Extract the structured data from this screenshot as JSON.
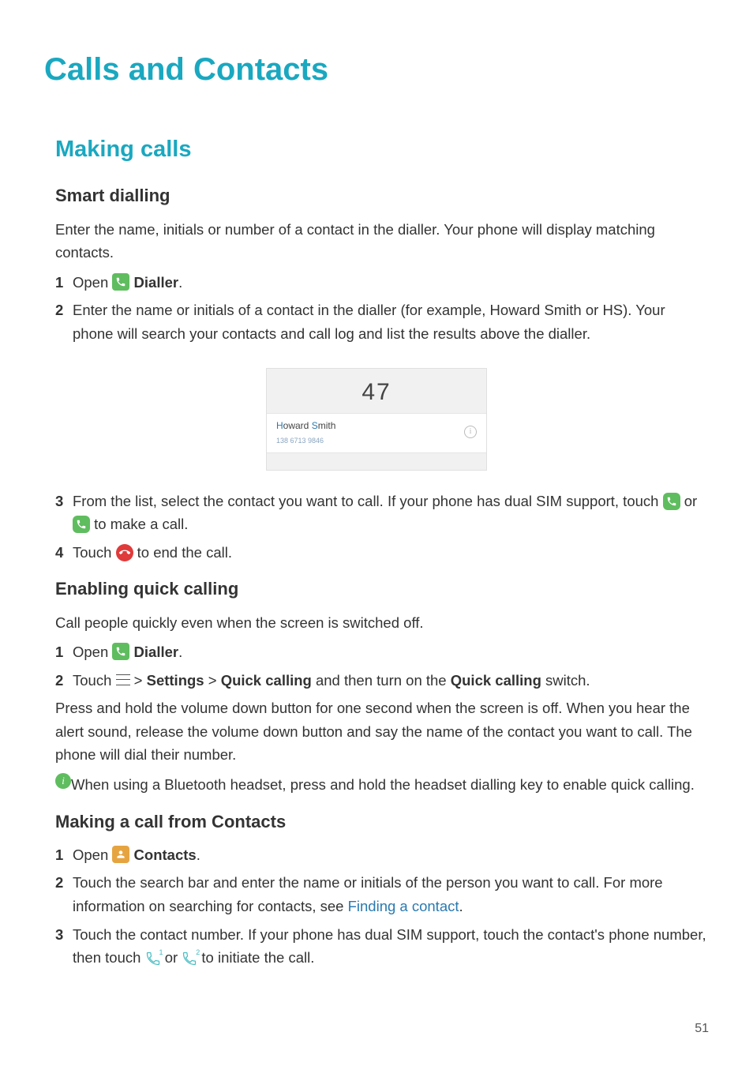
{
  "page": {
    "number": "51"
  },
  "title": "Calls and Contacts",
  "section_making_calls": {
    "heading": "Making calls",
    "smart_dialling": {
      "heading": "Smart dialling",
      "intro": "Enter the name, initials or number of a contact in the dialler. Your phone will display matching contacts.",
      "step1_a": "Open ",
      "step1_b": "Dialler",
      "step1_c": ".",
      "step2": "Enter the name or initials of a contact in the dialler (for example, Howard Smith or HS). Your phone will search your contacts and call log and list the results above the dialler.",
      "screenshot": {
        "number": "47",
        "name_highlight_1": "H",
        "name_plain_1": "oward ",
        "name_highlight_2": "S",
        "name_plain_2": "mith",
        "subnumber": "138 6713 9846"
      },
      "step3_a": "From the list, select the contact you want to call. If your phone has dual SIM support, touch ",
      "step3_b": " or ",
      "step3_c": " to make a call.",
      "step4_a": "Touch ",
      "step4_b": " to end the call."
    },
    "quick_calling": {
      "heading": "Enabling quick calling",
      "intro": "Call people quickly even when the screen is switched off.",
      "step1_a": "Open ",
      "step1_b": "Dialler",
      "step1_c": ".",
      "step2_a": "Touch ",
      "step2_b": " > ",
      "step2_c": "Settings",
      "step2_d": " > ",
      "step2_e": "Quick calling",
      "step2_f": " and then turn on the ",
      "step2_g": "Quick calling",
      "step2_h": " switch.",
      "para": "Press and hold the volume down button for one second when the screen is off. When you hear the alert sound, release the volume down button and say the name of the contact you want to call. The phone will dial their number.",
      "info": "When using a Bluetooth headset, press and hold the headset dialling key to enable quick calling."
    },
    "from_contacts": {
      "heading": "Making a call from Contacts",
      "step1_a": "Open ",
      "step1_b": "Contacts",
      "step1_c": ".",
      "step2_a": "Touch the search bar and enter the name or initials of the person you want to call. For more information on searching for contacts, see ",
      "step2_link": "Finding a contact",
      "step2_b": ".",
      "step3_a": "Touch the contact number. If your phone has dual SIM support, touch the contact's phone number, then touch ",
      "step3_b": " or ",
      "step3_c": " to initiate the call."
    }
  },
  "list_nums": {
    "n1": "1",
    "n2": "2",
    "n3": "3",
    "n4": "4"
  }
}
